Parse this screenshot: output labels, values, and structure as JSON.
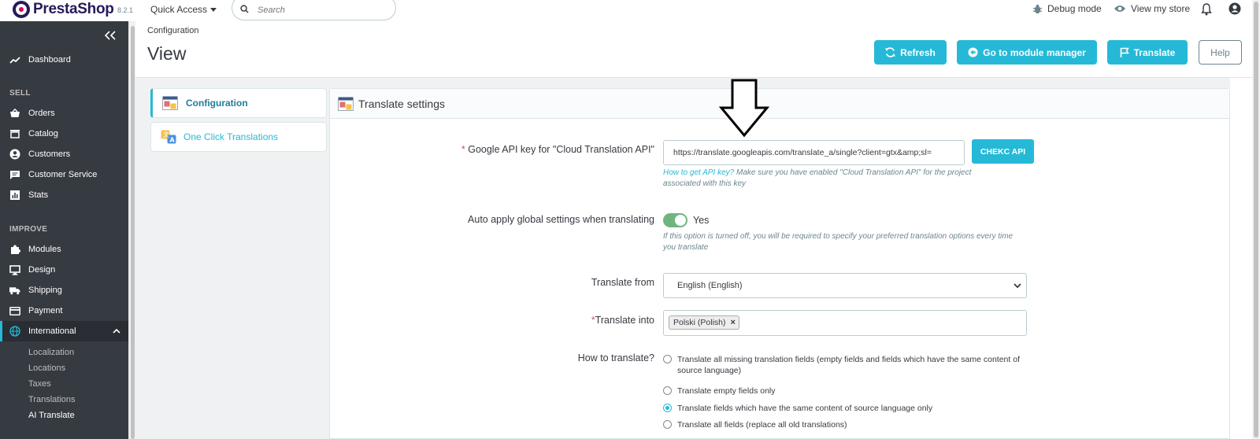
{
  "header": {
    "logo_text": "PrestaShop",
    "version": "8.2.1",
    "quick_access": "Quick Access",
    "search_placeholder": "Search",
    "debug_mode": "Debug mode",
    "view_store": "View my store"
  },
  "sidebar": {
    "dashboard": "Dashboard",
    "sell_title": "SELL",
    "sell": [
      "Orders",
      "Catalog",
      "Customers",
      "Customer Service",
      "Stats"
    ],
    "improve_title": "IMPROVE",
    "improve": [
      "Modules",
      "Design",
      "Shipping",
      "Payment",
      "International"
    ],
    "international_sub": [
      "Localization",
      "Locations",
      "Taxes",
      "Translations",
      "AI Translate"
    ]
  },
  "page": {
    "breadcrumb": "Configuration",
    "title": "View",
    "buttons": {
      "refresh": "Refresh",
      "module_manager": "Go to module manager",
      "translate": "Translate",
      "help": "Help"
    }
  },
  "tabs": [
    "Configuration",
    "One Click Translations"
  ],
  "panel": {
    "title": "Translate settings",
    "api_key_label": "Google API key for \"Cloud Translation API\"",
    "api_key_value": "https://translate.googleapis.com/translate_a/single?client=gtx&amp;sl=",
    "check_api": "CHEKC API",
    "api_help_link": "How to get API key?",
    "api_help_text1": " Make sure you have enabled \"Cloud Translation API\" for the project",
    "api_help_text2": "associated with this key",
    "auto_apply_label": "Auto apply global settings when translating",
    "auto_apply_value": "Yes",
    "auto_apply_help1": "If this option is turned off, you will be required to specify your preferred translation options every time",
    "auto_apply_help2": "you translate",
    "translate_from_label": "Translate from",
    "translate_from_value": "English (English)",
    "translate_into_label": "Translate into",
    "translate_into_tag": "Polski (Polish)",
    "how_label": "How to translate?",
    "how_options": [
      "Translate all missing translation fields (empty fields and fields which have the same content of",
      "source language)",
      "Translate empty fields only",
      "Translate fields which have the same content of source language only",
      "Translate all fields (replace all old translations)"
    ],
    "how_selected": 2
  },
  "colors": {
    "accent": "#25b9d7",
    "sidebar_bg": "#363a41",
    "toggle_on": "#70b580"
  }
}
